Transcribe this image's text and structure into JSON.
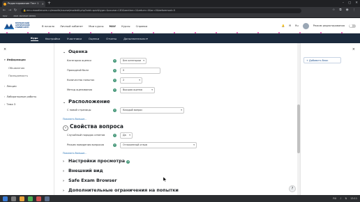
{
  "browser": {
    "tab_title": "Редактирование Тест 1",
    "url": "mnu.moodlenorm.ru/moodle/course/modedit.php?add=quiz&type=&course=181&section=1&return=0&sr=0&beforemod=0",
    "bookmarks": [
      "МАУ",
      "МОЕ ЛИЧНОЕ МЕНЮ"
    ]
  },
  "header": {
    "logo_text": "МУРМАНСКИЙ АРКТИЧЕСКИЙ УНИВЕРСИТЕТ",
    "nav": [
      "В начало",
      "Личный кабинет",
      "Мои курсы",
      "МАУ",
      "Курсы",
      "Справка"
    ],
    "lang": "Ru",
    "edit_mode_label": "Режим редактирования"
  },
  "course_nav": [
    "Курс",
    "Настройки",
    "Участники",
    "Оценки",
    "Отчеты",
    "Дополнительно"
  ],
  "left_drawer": {
    "sections": [
      {
        "label": "Информация",
        "expanded": true,
        "items": [
          "Объявления",
          "Посещаемость"
        ]
      },
      {
        "label": "Лекции",
        "expanded": false,
        "items": []
      },
      {
        "label": "Лабораторные работы",
        "expanded": false,
        "items": []
      },
      {
        "label": "Тема 3",
        "expanded": false,
        "items": []
      }
    ]
  },
  "right_drawer": {
    "add_block_label": "+ Добавить блок"
  },
  "form": {
    "grade_section": {
      "title": "Оценка",
      "fields": [
        {
          "label": "Категория оценки",
          "value": "Без категории",
          "type": "select"
        },
        {
          "label": "Проходной балл",
          "value": "0",
          "type": "input"
        },
        {
          "label": "Количество попыток",
          "value": "2",
          "type": "select"
        },
        {
          "label": "Метод оценивания",
          "value": "Высшая оценка",
          "type": "select"
        }
      ]
    },
    "layout_section": {
      "title": "Расположение",
      "fields": [
        {
          "label": "С новой страницы",
          "value": "Каждый вопрос",
          "type": "select"
        }
      ],
      "show_more": "Показать больше..."
    },
    "question_section": {
      "title": "Свойства вопроса",
      "fields": [
        {
          "label": "Случайный порядок ответов",
          "value": "Да",
          "type": "select"
        },
        {
          "label": "Режим поведения вопросов",
          "value": "Отложенный отзыв",
          "type": "select"
        }
      ],
      "show_more": "Показать больше..."
    },
    "collapsed_sections": [
      "Настройки просмотра",
      "Внешний вид",
      "Safe Exam Browser",
      "Дополнительные ограничения на попытки"
    ]
  },
  "taskbar": {
    "clock": "13:11",
    "lang": "RU"
  },
  "colors": {
    "nav_dark": "#1b2a3d",
    "help_icon": "#4a9a7c",
    "link": "#1a6bb3"
  }
}
